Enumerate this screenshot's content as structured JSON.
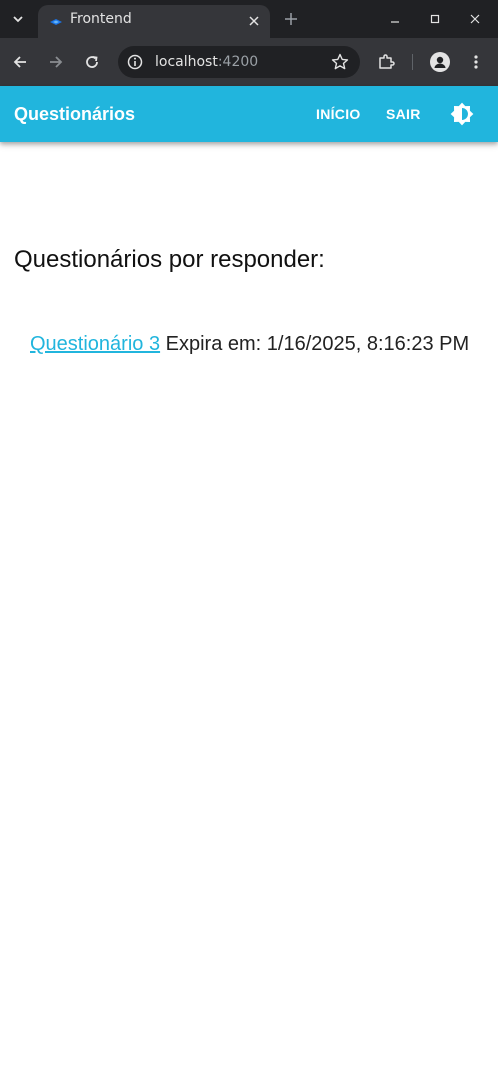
{
  "browser": {
    "tab_title": "Frontend",
    "url_host": "localhost",
    "url_port": ":4200"
  },
  "app": {
    "title": "Questionários",
    "nav": {
      "home_label": "INÍCIO",
      "logout_label": "SAIR"
    }
  },
  "main": {
    "heading": "Questionários por responder:",
    "questionnaires": [
      {
        "name": "Questionário 3",
        "expiry_text": "Expira em: 1/16/2025, 8:16:23 PM"
      }
    ]
  },
  "colors": {
    "primary": "#21b5dd",
    "chrome_dark": "#202124",
    "chrome_toolbar": "#35363a"
  }
}
